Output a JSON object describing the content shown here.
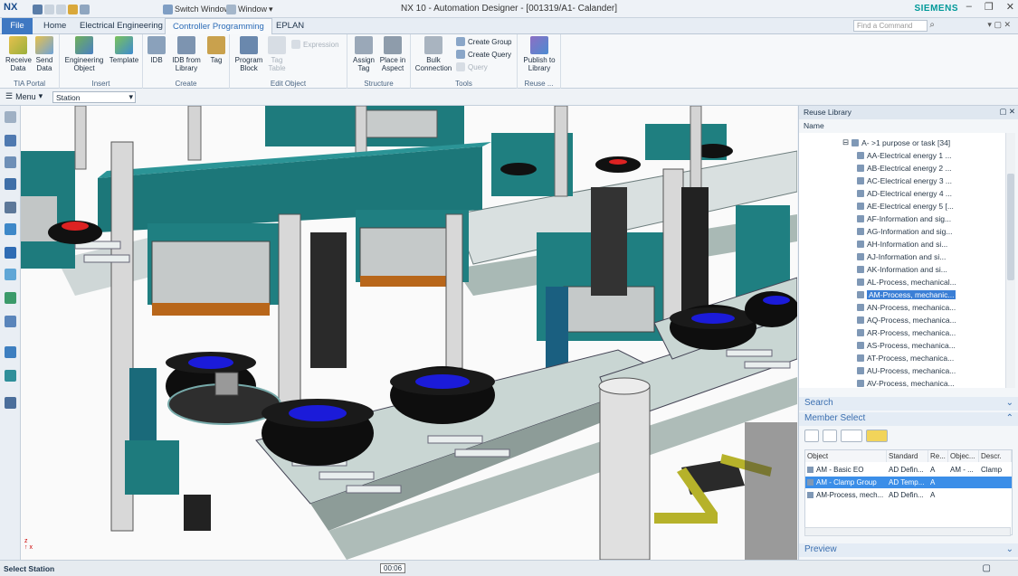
{
  "app": {
    "logo": "NX",
    "title": "NX 10 - Automation Designer - [001319/A1- Calander]",
    "brand": "SIEMENS",
    "switch_window": "Switch Window",
    "window_menu": "Window"
  },
  "tabs": [
    "File",
    "Home",
    "Electrical Engineering",
    "Controller Programming",
    "EPLAN"
  ],
  "find_placeholder": "Find a Command",
  "ribbon": {
    "groups": [
      {
        "label": "TIA Portal",
        "buttons": [
          "Receive Data",
          "Send Data"
        ]
      },
      {
        "label": "Insert",
        "buttons": [
          "Engineering Object",
          "Template"
        ]
      },
      {
        "label": "Create",
        "buttons": [
          "IDB",
          "IDB from Library",
          "Tag"
        ]
      },
      {
        "label": "Edit Object",
        "buttons": [
          "Program Block",
          "Tag Table"
        ],
        "small": [
          "Expression"
        ]
      },
      {
        "label": "Structure",
        "buttons": [
          "Assign Tag",
          "Place in Aspect"
        ]
      },
      {
        "label": "Tools",
        "buttons": [
          "Bulk Connection"
        ],
        "small": [
          "Create Group",
          "Create Query",
          "Query"
        ]
      },
      {
        "label": "Reuse ...",
        "buttons": [
          "Publish to Library"
        ]
      }
    ]
  },
  "toolbar2": {
    "menu": "Menu",
    "station": "Station"
  },
  "reuse_library": {
    "title": "Reuse Library",
    "column": "Name",
    "parent": "A-  >1 purpose or task [34]",
    "items": [
      "AA-Electrical energy 1 ...",
      "AB-Electrical energy 2 ...",
      "AC-Electrical energy 3 ...",
      "AD-Electrical energy 4 ...",
      "AE-Electrical energy 5 [...",
      "AF-Information and sig...",
      "AG-Information and sig...",
      "AH-Information and si...",
      "AJ-Information and si...",
      "AK-Information and si...",
      "AL-Process, mechanical...",
      "AM-Process, mechanic...",
      "AN-Process, mechanica...",
      "AQ-Process, mechanica...",
      "AR-Process, mechanica...",
      "AS-Process, mechanica...",
      "AT-Process, mechanica...",
      "AU-Process, mechanica...",
      "AV-Process, mechanica..."
    ],
    "selected_index": 11
  },
  "search_label": "Search",
  "member_select": {
    "title": "Member Select",
    "columns": [
      "Object",
      "Standard",
      "Re...",
      "Objec...",
      "Descr."
    ],
    "rows": [
      [
        "AM - Basic EO",
        "AD Defin...",
        "A",
        "AM - ...",
        "Clamp"
      ],
      [
        "AM - Clamp Group",
        "AD Temp...",
        "A",
        "",
        ""
      ],
      [
        "AM-Process, mech...",
        "AD Defin...",
        "A",
        "",
        ""
      ]
    ],
    "selected_row": 1
  },
  "preview_label": "Preview",
  "status": {
    "text": "Select Station",
    "timer": "00:06"
  },
  "colors": {
    "accent": "#3b7fd6",
    "teal": "#1f7d80",
    "brand": "#009999"
  }
}
